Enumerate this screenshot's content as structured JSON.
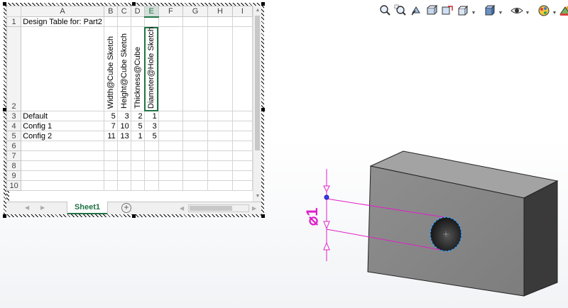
{
  "toolbar": {
    "buttons": [
      {
        "name": "zoom-to-fit-icon"
      },
      {
        "name": "zoom-to-area-icon"
      },
      {
        "name": "previous-view-icon"
      },
      {
        "name": "section-view-icon"
      },
      {
        "name": "dynamic-annotation-icon"
      },
      {
        "name": "view-orientation-icon"
      },
      {
        "name": "display-style-icon"
      },
      {
        "name": "hide-show-items-icon"
      },
      {
        "name": "edit-appearance-icon"
      },
      {
        "name": "apply-scene-icon"
      },
      {
        "name": "view-settings-icon"
      }
    ]
  },
  "sheet": {
    "col_headers": [
      "A",
      "B",
      "C",
      "D",
      "E",
      "F",
      "G",
      "H",
      "I"
    ],
    "row_headers": [
      "1",
      "2",
      "3",
      "4",
      "5",
      "6",
      "7",
      "8",
      "9",
      "10"
    ],
    "title_cell": "Design Table for: Part2",
    "params": [
      "Width@Cube Sketch",
      "Height@Cube Sketch",
      "Thickness@Cube",
      "Diameter@Hole Sketch"
    ],
    "rows": [
      {
        "config": "Default",
        "values": [
          "5",
          "3",
          "2",
          "1"
        ]
      },
      {
        "config": "Config 1",
        "values": [
          "7",
          "10",
          "5",
          "3"
        ]
      },
      {
        "config": "Config 2",
        "values": [
          "11",
          "13",
          "1",
          "5"
        ]
      }
    ],
    "tab_name": "Sheet1",
    "add_sheet": "⊕"
  },
  "dimension": {
    "label": "⌀1"
  },
  "colors": {
    "excel_green": "#217346",
    "dimension_magenta": "#e020c8",
    "cube_front": "#8a8a8a",
    "cube_top": "#9a9a9a",
    "cube_side": "#333333"
  }
}
